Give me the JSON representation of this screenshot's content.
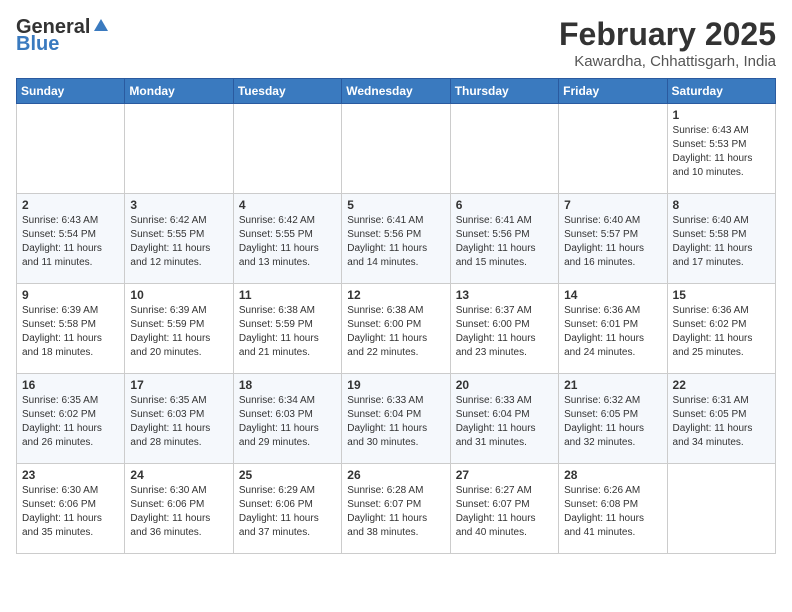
{
  "header": {
    "logo_general": "General",
    "logo_blue": "Blue",
    "month_title": "February 2025",
    "location": "Kawardha, Chhattisgarh, India"
  },
  "weekdays": [
    "Sunday",
    "Monday",
    "Tuesday",
    "Wednesday",
    "Thursday",
    "Friday",
    "Saturday"
  ],
  "weeks": [
    [
      {
        "day": "",
        "info": ""
      },
      {
        "day": "",
        "info": ""
      },
      {
        "day": "",
        "info": ""
      },
      {
        "day": "",
        "info": ""
      },
      {
        "day": "",
        "info": ""
      },
      {
        "day": "",
        "info": ""
      },
      {
        "day": "1",
        "info": "Sunrise: 6:43 AM\nSunset: 5:53 PM\nDaylight: 11 hours\nand 10 minutes."
      }
    ],
    [
      {
        "day": "2",
        "info": "Sunrise: 6:43 AM\nSunset: 5:54 PM\nDaylight: 11 hours\nand 11 minutes."
      },
      {
        "day": "3",
        "info": "Sunrise: 6:42 AM\nSunset: 5:55 PM\nDaylight: 11 hours\nand 12 minutes."
      },
      {
        "day": "4",
        "info": "Sunrise: 6:42 AM\nSunset: 5:55 PM\nDaylight: 11 hours\nand 13 minutes."
      },
      {
        "day": "5",
        "info": "Sunrise: 6:41 AM\nSunset: 5:56 PM\nDaylight: 11 hours\nand 14 minutes."
      },
      {
        "day": "6",
        "info": "Sunrise: 6:41 AM\nSunset: 5:56 PM\nDaylight: 11 hours\nand 15 minutes."
      },
      {
        "day": "7",
        "info": "Sunrise: 6:40 AM\nSunset: 5:57 PM\nDaylight: 11 hours\nand 16 minutes."
      },
      {
        "day": "8",
        "info": "Sunrise: 6:40 AM\nSunset: 5:58 PM\nDaylight: 11 hours\nand 17 minutes."
      }
    ],
    [
      {
        "day": "9",
        "info": "Sunrise: 6:39 AM\nSunset: 5:58 PM\nDaylight: 11 hours\nand 18 minutes."
      },
      {
        "day": "10",
        "info": "Sunrise: 6:39 AM\nSunset: 5:59 PM\nDaylight: 11 hours\nand 20 minutes."
      },
      {
        "day": "11",
        "info": "Sunrise: 6:38 AM\nSunset: 5:59 PM\nDaylight: 11 hours\nand 21 minutes."
      },
      {
        "day": "12",
        "info": "Sunrise: 6:38 AM\nSunset: 6:00 PM\nDaylight: 11 hours\nand 22 minutes."
      },
      {
        "day": "13",
        "info": "Sunrise: 6:37 AM\nSunset: 6:00 PM\nDaylight: 11 hours\nand 23 minutes."
      },
      {
        "day": "14",
        "info": "Sunrise: 6:36 AM\nSunset: 6:01 PM\nDaylight: 11 hours\nand 24 minutes."
      },
      {
        "day": "15",
        "info": "Sunrise: 6:36 AM\nSunset: 6:02 PM\nDaylight: 11 hours\nand 25 minutes."
      }
    ],
    [
      {
        "day": "16",
        "info": "Sunrise: 6:35 AM\nSunset: 6:02 PM\nDaylight: 11 hours\nand 26 minutes."
      },
      {
        "day": "17",
        "info": "Sunrise: 6:35 AM\nSunset: 6:03 PM\nDaylight: 11 hours\nand 28 minutes."
      },
      {
        "day": "18",
        "info": "Sunrise: 6:34 AM\nSunset: 6:03 PM\nDaylight: 11 hours\nand 29 minutes."
      },
      {
        "day": "19",
        "info": "Sunrise: 6:33 AM\nSunset: 6:04 PM\nDaylight: 11 hours\nand 30 minutes."
      },
      {
        "day": "20",
        "info": "Sunrise: 6:33 AM\nSunset: 6:04 PM\nDaylight: 11 hours\nand 31 minutes."
      },
      {
        "day": "21",
        "info": "Sunrise: 6:32 AM\nSunset: 6:05 PM\nDaylight: 11 hours\nand 32 minutes."
      },
      {
        "day": "22",
        "info": "Sunrise: 6:31 AM\nSunset: 6:05 PM\nDaylight: 11 hours\nand 34 minutes."
      }
    ],
    [
      {
        "day": "23",
        "info": "Sunrise: 6:30 AM\nSunset: 6:06 PM\nDaylight: 11 hours\nand 35 minutes."
      },
      {
        "day": "24",
        "info": "Sunrise: 6:30 AM\nSunset: 6:06 PM\nDaylight: 11 hours\nand 36 minutes."
      },
      {
        "day": "25",
        "info": "Sunrise: 6:29 AM\nSunset: 6:06 PM\nDaylight: 11 hours\nand 37 minutes."
      },
      {
        "day": "26",
        "info": "Sunrise: 6:28 AM\nSunset: 6:07 PM\nDaylight: 11 hours\nand 38 minutes."
      },
      {
        "day": "27",
        "info": "Sunrise: 6:27 AM\nSunset: 6:07 PM\nDaylight: 11 hours\nand 40 minutes."
      },
      {
        "day": "28",
        "info": "Sunrise: 6:26 AM\nSunset: 6:08 PM\nDaylight: 11 hours\nand 41 minutes."
      },
      {
        "day": "",
        "info": ""
      }
    ]
  ]
}
